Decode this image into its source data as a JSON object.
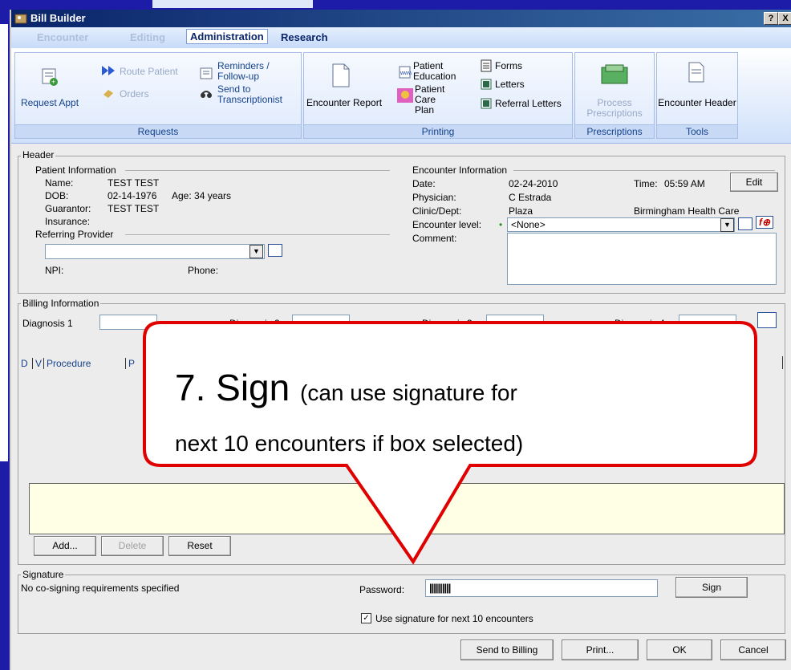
{
  "window": {
    "title": "Bill Builder",
    "help_btn": "?",
    "close_btn": "X"
  },
  "menu": {
    "tabs": [
      "Encounter",
      "Editing",
      "Administration",
      "Research"
    ]
  },
  "ribbon": {
    "requests": {
      "label": "Requests",
      "request_appt": "Request Appt",
      "route_patient": "Route Patient",
      "orders": "Orders",
      "reminders": "Reminders / Follow-up",
      "send_to": "Send to Transcriptionist"
    },
    "printing": {
      "label": "Printing",
      "encounter_report": "Encounter Report",
      "patient_education": "Patient Education",
      "patient_care_plan": "Patient Care Plan",
      "forms": "Forms",
      "letters": "Letters",
      "referral_letters": "Referral Letters"
    },
    "prescriptions": {
      "label": "Prescriptions",
      "process": "Process Prescriptions"
    },
    "tools": {
      "label": "Tools",
      "encounter_header": "Encounter Header"
    }
  },
  "header": {
    "legend": "Header",
    "patient_info": "Patient Information",
    "name_label": "Name:",
    "name": "TEST TEST",
    "dob_label": "DOB:",
    "dob": "02-14-1976",
    "age": "Age: 34 years",
    "guarantor_label": "Guarantor:",
    "guarantor": "TEST TEST",
    "insurance_label": "Insurance:",
    "referring_provider": "Referring Provider",
    "npi_label": "NPI:",
    "phone_label": "Phone:",
    "encounter_info": "Encounter Information",
    "date_label": "Date:",
    "date": "02-24-2010",
    "time_label": "Time:",
    "time": "05:59 AM",
    "edit": "Edit",
    "physician_label": "Physician:",
    "physician": "C Estrada",
    "clinic_label": "Clinic/Dept:",
    "clinic": "Plaza",
    "clinic_name": "Birmingham Health Care",
    "encounter_level_label": "Encounter level:",
    "encounter_level": "<None>",
    "comment_label": "Comment:"
  },
  "billing": {
    "legend": "Billing Information",
    "diagnosis": [
      "Diagnosis 1",
      "Diagnosis 2",
      "Diagnosis 3",
      "Diagnosis 4"
    ],
    "col_d": "D",
    "col_v": "V",
    "col_procedure": "Procedure",
    "col_p": "P",
    "add": "Add...",
    "delete": "Delete",
    "reset": "Reset"
  },
  "signature": {
    "legend": "Signature",
    "status": "No co-signing requirements specified",
    "password_label": "Password:",
    "password_value": "||||||||||",
    "sign": "Sign",
    "use_sig": "Use signature for next 10 encounters",
    "use_sig_checked": "✓"
  },
  "footer": {
    "send_billing": "Send to Billing",
    "print": "Print...",
    "ok": "OK",
    "cancel": "Cancel"
  },
  "callout": {
    "line1_big": "7. Sign",
    "line1_small": "(can use signature for",
    "line2": "next 10 encounters if box selected)"
  },
  "colors": {
    "callout_border": "#e00000",
    "title_bar": "#0a246a",
    "background": "#1c1ca8"
  }
}
